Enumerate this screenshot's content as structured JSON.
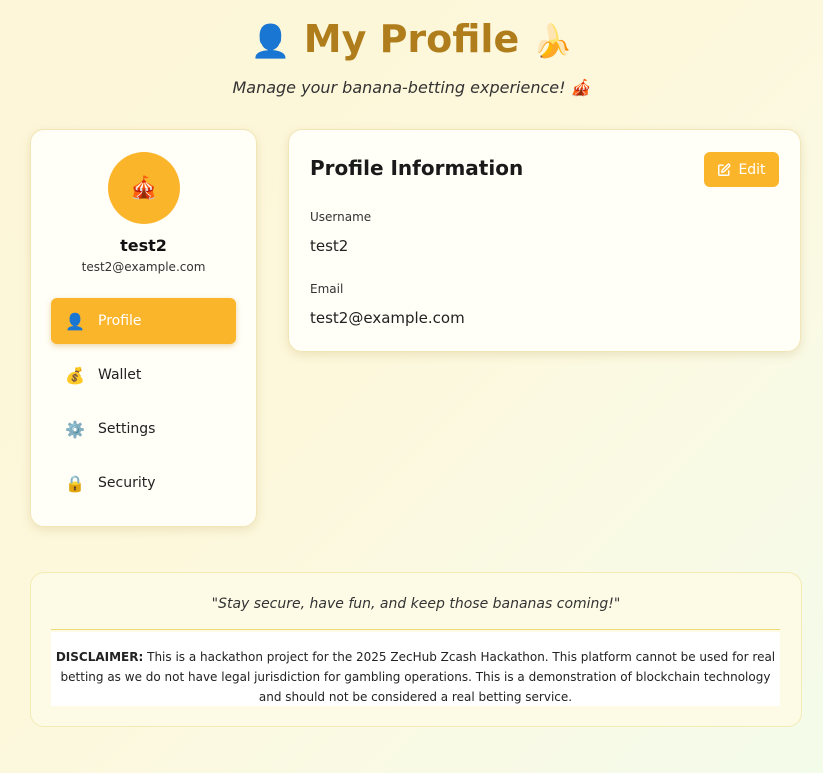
{
  "header": {
    "title": "My Profile",
    "title_icon_left": "👤",
    "title_icon_right": "🍌",
    "subtitle": "Manage your banana-betting experience! 🎪"
  },
  "sidebar": {
    "avatar_emoji": "🎪",
    "username": "test2",
    "email": "test2@example.com",
    "items": [
      {
        "icon": "👤",
        "icon_name": "user-icon",
        "label": "Profile",
        "active": true
      },
      {
        "icon": "💰",
        "icon_name": "money-bag-icon",
        "label": "Wallet",
        "active": false
      },
      {
        "icon": "⚙️",
        "icon_name": "gear-icon",
        "label": "Settings",
        "active": false
      },
      {
        "icon": "🔒",
        "icon_name": "lock-icon",
        "label": "Security",
        "active": false
      }
    ]
  },
  "profile": {
    "title": "Profile Information",
    "edit_label": "Edit",
    "username_label": "Username",
    "username_value": "test2",
    "email_label": "Email",
    "email_value": "test2@example.com"
  },
  "footer": {
    "quote": "\"Stay secure, have fun, and keep those bananas coming!\"",
    "disclaimer_label": "DISCLAIMER:",
    "disclaimer_text": " This is a hackathon project for the 2025 ZecHub Zcash Hackathon. This platform cannot be used for real betting as we do not have legal jurisdiction for gambling operations. This is a demonstration of blockchain technology and should not be considered a real betting service."
  },
  "colors": {
    "accent": "#fbb52b",
    "title_color": "#b07d1c",
    "card_bg": "#fffef7"
  }
}
